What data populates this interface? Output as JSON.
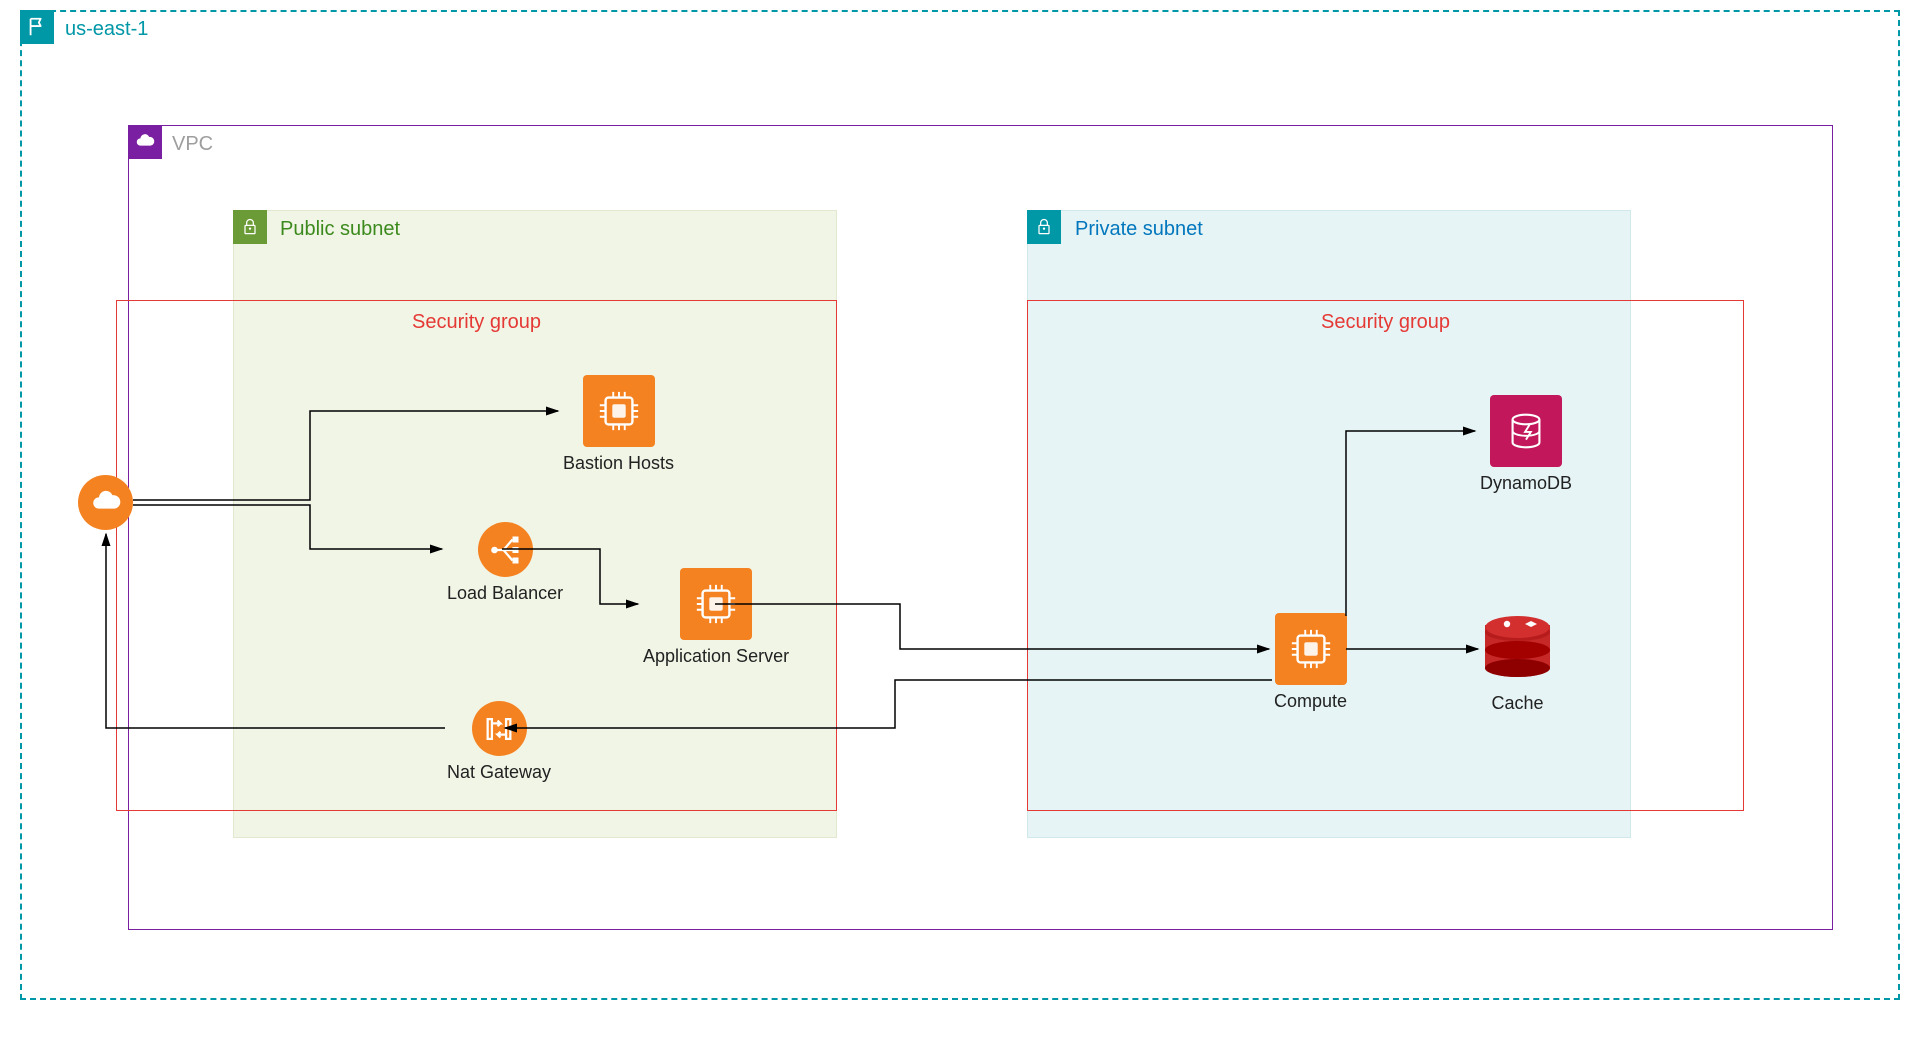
{
  "region": {
    "name": "us-east-1"
  },
  "vpc": {
    "label": "VPC"
  },
  "public_subnet": {
    "label": "Public subnet",
    "security_group_label": "Security group",
    "nodes": {
      "bastion": "Bastion Hosts",
      "load_balancer": "Load Balancer",
      "app_server": "Application Server",
      "nat_gateway": "Nat Gateway"
    }
  },
  "private_subnet": {
    "label": "Private subnet",
    "security_group_label": "Security group",
    "nodes": {
      "compute": "Compute",
      "dynamodb": "DynamoDB",
      "cache": "Cache"
    }
  },
  "external": {
    "internet": "Internet"
  },
  "connections": [
    {
      "from": "internet",
      "to": "bastion"
    },
    {
      "from": "internet",
      "to": "load_balancer"
    },
    {
      "from": "load_balancer",
      "to": "app_server"
    },
    {
      "from": "app_server",
      "to": "compute"
    },
    {
      "from": "compute",
      "to": "dynamodb"
    },
    {
      "from": "compute",
      "to": "cache"
    },
    {
      "from": "compute",
      "to": "nat_gateway"
    },
    {
      "from": "nat_gateway",
      "to": "internet"
    }
  ]
}
